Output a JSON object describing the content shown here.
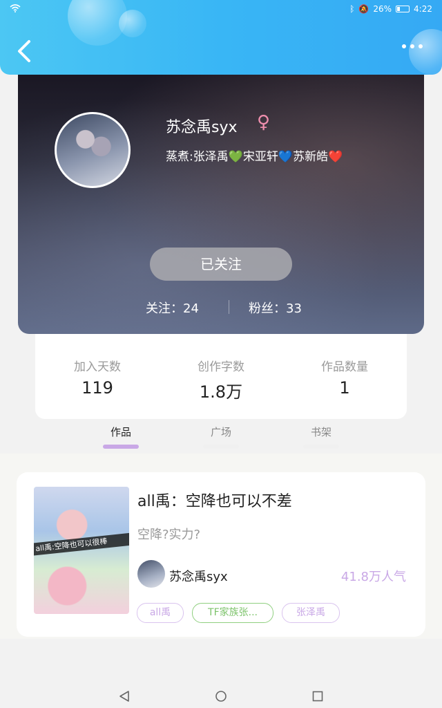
{
  "status_bar": {
    "battery_text": "26%",
    "time": "4:22",
    "battery_level": 0.26
  },
  "header": {
    "back_icon": "chevron-left-icon",
    "more_icon": "more-dots-icon"
  },
  "profile": {
    "name": "苏念禹syx",
    "gender_symbol": "♀",
    "bio_parts": [
      "蒸煮:张泽禹",
      "💚",
      "宋亚轩",
      "💙",
      "苏新皓",
      "❤️"
    ],
    "follow_button": "已关注",
    "following_label": "关注：24",
    "followers_label": "粉丝：33"
  },
  "stats": [
    {
      "label": "加入天数",
      "value": "119"
    },
    {
      "label": "创作字数",
      "value": "1.8万"
    },
    {
      "label": "作品数量",
      "value": "1"
    }
  ],
  "tabs": [
    {
      "label": "作品",
      "active": true
    },
    {
      "label": "广场",
      "active": false
    },
    {
      "label": "书架",
      "active": false
    }
  ],
  "work": {
    "cover_text": "all禹:空降也可以很棒",
    "title": "all禹：空降也可以不差",
    "description": "空降?实力?",
    "author": "苏念禹syx",
    "popularity": "41.8万人气",
    "tags": [
      "all禹",
      "TF家族张...",
      "张泽禹"
    ]
  },
  "nav": {
    "back": "triangle-back-icon",
    "home": "circle-home-icon",
    "recents": "square-recents-icon"
  },
  "colors": {
    "accent": "#c9a8e6",
    "header_blue": "#39b6f5",
    "tag_green": "#7cc36a"
  }
}
